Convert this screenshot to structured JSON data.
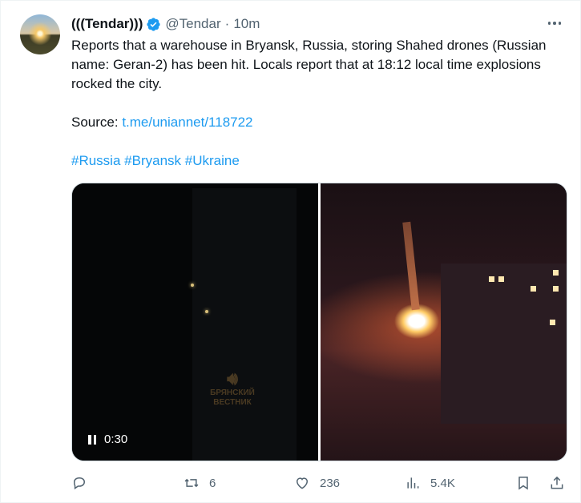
{
  "tweet": {
    "display_name": "(((Tendar)))",
    "handle": "@Tendar",
    "separator": "·",
    "time": "10m",
    "text_line1": "Reports that a warehouse in Bryansk, Russia, storing Shahed drones (Russian name: Geran-2) has been hit. Locals report that at 18:12 local time explosions rocked the city.",
    "source_label": "Source: ",
    "source_link": "t.me/uniannet/118722",
    "hashtags": [
      "#Russia",
      "#Bryansk",
      "#Ukraine"
    ],
    "video": {
      "elapsed": "0:30",
      "watermark_line1": "БРЯНСКИЙ",
      "watermark_line2": "ВЕСТНИК"
    },
    "actions": {
      "replies": "",
      "retweets": "6",
      "likes": "236",
      "views": "5.4K"
    }
  },
  "colors": {
    "link": "#1d9bf0",
    "verified": "#1d9bf0",
    "muted": "#536471"
  }
}
